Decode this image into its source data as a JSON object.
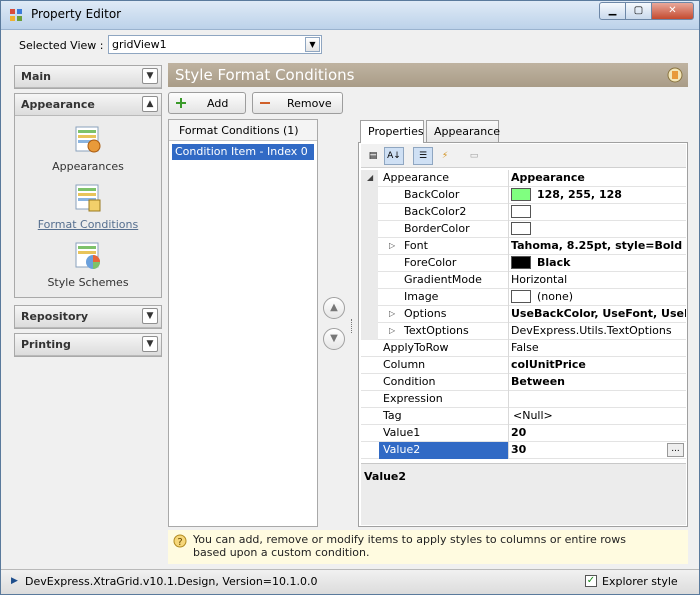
{
  "window": {
    "title": "Property Editor"
  },
  "selected_view": {
    "label": "Selected View :",
    "value": "gridView1"
  },
  "nav": {
    "groups": [
      {
        "label": "Main",
        "expanded": false
      },
      {
        "label": "Appearance",
        "expanded": true
      },
      {
        "label": "Repository",
        "expanded": false
      },
      {
        "label": "Printing",
        "expanded": false
      }
    ],
    "items": [
      {
        "label": "Appearances",
        "icon": "appearances-icon"
      },
      {
        "label": "Format Conditions",
        "icon": "format-conditions-icon",
        "active": true
      },
      {
        "label": "Style Schemes",
        "icon": "style-schemes-icon"
      }
    ]
  },
  "banner": {
    "title": "Style Format Conditions"
  },
  "toolbar": {
    "add_label": "Add",
    "remove_label": "Remove"
  },
  "format_conditions": {
    "header": "Format Conditions (1)",
    "items": [
      "Condition Item - Index 0"
    ]
  },
  "tabs": [
    {
      "label": "Properties",
      "active": true
    },
    {
      "label": "Appearance",
      "active": false
    }
  ],
  "property_grid": {
    "rows": [
      {
        "name": "Appearance",
        "value": "Appearance",
        "category": true,
        "bold": true
      },
      {
        "name": "BackColor",
        "value": "128, 255, 128",
        "swatch": "#80ff80",
        "bold": true
      },
      {
        "name": "BackColor2",
        "value": "",
        "swatch": "#ffffff"
      },
      {
        "name": "BorderColor",
        "value": "",
        "swatch": "#ffffff"
      },
      {
        "name": "Font",
        "value": "Tahoma, 8.25pt, style=Bold",
        "expandable": true,
        "bold": true
      },
      {
        "name": "ForeColor",
        "value": "Black",
        "swatch": "#000000",
        "bold": true
      },
      {
        "name": "GradientMode",
        "value": "Horizontal"
      },
      {
        "name": "Image",
        "value": "(none)",
        "swatch": "#ffffff"
      },
      {
        "name": "Options",
        "value": "UseBackColor, UseFont, UseFor",
        "expandable": true,
        "bold": true
      },
      {
        "name": "TextOptions",
        "value": "DevExpress.Utils.TextOptions",
        "expandable": true
      },
      {
        "name": "ApplyToRow",
        "value": "False",
        "top": true
      },
      {
        "name": "Column",
        "value": "colUnitPrice",
        "top": true,
        "bold": true
      },
      {
        "name": "Condition",
        "value": "Between",
        "top": true,
        "bold": true
      },
      {
        "name": "Expression",
        "value": "",
        "top": true
      },
      {
        "name": "Tag",
        "value": "<Null>",
        "top": true
      },
      {
        "name": "Value1",
        "value": "20",
        "top": true,
        "bold": true
      },
      {
        "name": "Value2",
        "value": "30",
        "top": true,
        "bold": true,
        "selected": true
      }
    ],
    "description": "Value2"
  },
  "hint": {
    "text": "You can add, remove or modify items to apply styles to columns or entire rows based upon a custom condition."
  },
  "status": {
    "text": "DevExpress.XtraGrid.v10.1.Design, Version=10.1.0.0",
    "checkbox_label": "Explorer style",
    "checked": true
  }
}
